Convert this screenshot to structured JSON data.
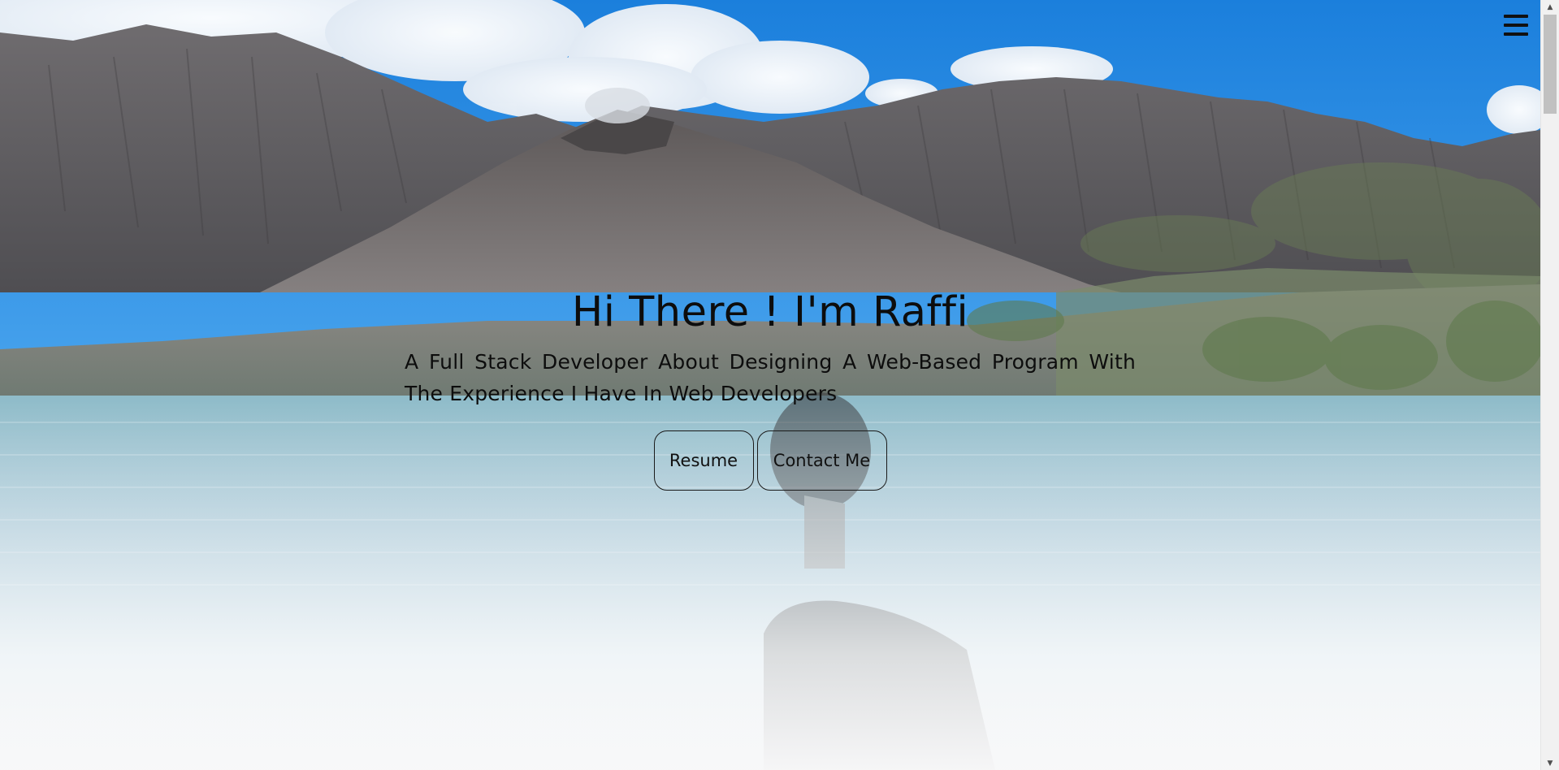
{
  "nav": {
    "menu_icon": "hamburger-menu-icon"
  },
  "hero": {
    "title": "Hi There ! I'm Raffi",
    "subtitle": "A Full Stack Developer About Designing A Web-Based Program With The Experience I Have In Web Developers",
    "buttons": {
      "resume_label": "Resume",
      "contact_label": "Contact Me"
    },
    "background": "mountain-lake-photo"
  },
  "scrollbar": {
    "up_icon": "scroll-up-arrow-icon",
    "down_icon": "scroll-down-arrow-icon"
  },
  "colors": {
    "sky": "#1f86e0",
    "mountain": "#5d5a5c",
    "lake": "#9fc3cf",
    "text": "#0d0d0d",
    "scrollbar_track": "#f1f1f1",
    "scrollbar_thumb": "#c1c1c1"
  }
}
